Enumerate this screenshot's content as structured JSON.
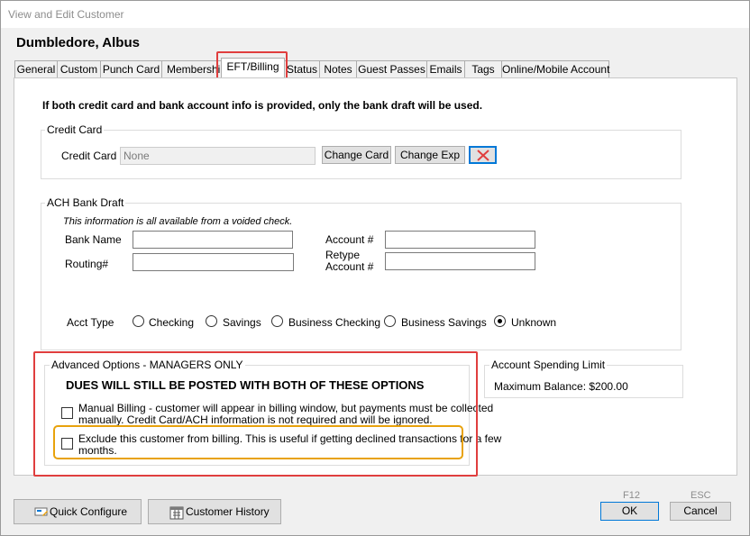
{
  "window": {
    "title": "View and Edit Customer"
  },
  "customer": {
    "name": "Dumbledore, Albus"
  },
  "tabs": [
    {
      "label": "General"
    },
    {
      "label": "Custom"
    },
    {
      "label": "Punch Card"
    },
    {
      "label": "Membership"
    },
    {
      "label": "EFT/Billing",
      "active": true
    },
    {
      "label": "Status"
    },
    {
      "label": "Notes"
    },
    {
      "label": "Guest Passes"
    },
    {
      "label": "Emails"
    },
    {
      "label": "Tags"
    },
    {
      "label": "Online/Mobile Account"
    }
  ],
  "notice": "If both credit card and bank account info is provided, only the bank draft will be used.",
  "credit_card": {
    "group_label": "Credit Card",
    "field_label": "Credit Card",
    "value": "None",
    "change_card_label": "Change Card",
    "change_exp_label": "Change Exp"
  },
  "ach": {
    "group_label": "ACH Bank Draft",
    "hint": "This information is all available from a voided check.",
    "bank_name_label": "Bank Name",
    "routing_label": "Routing#",
    "account_label": "Account #",
    "retype_label_line1": "Retype",
    "retype_label_line2": "Account #",
    "bank_name_value": "",
    "routing_value": "",
    "account_value": "",
    "retype_value": "",
    "acct_type_label": "Acct Type",
    "acct_types": [
      {
        "label": "Checking",
        "checked": false
      },
      {
        "label": "Savings",
        "checked": false
      },
      {
        "label": "Business Checking",
        "checked": false
      },
      {
        "label": "Business Savings",
        "checked": false
      },
      {
        "label": "Unknown",
        "checked": true
      }
    ]
  },
  "advanced": {
    "group_label": "Advanced Options - MANAGERS ONLY",
    "warning": "DUES WILL STILL BE POSTED WITH BOTH OF THESE OPTIONS",
    "manual_billing_line1": "Manual Billing - customer will appear in billing window, but payments must be collected",
    "manual_billing_line2": "manually. Credit Card/ACH information is not required and will be ignored.",
    "manual_billing_checked": false,
    "exclude_line1": "Exclude this customer from billing.  This is useful if getting declined transactions for a few",
    "exclude_line2": "months.",
    "exclude_checked": false
  },
  "spending_limit": {
    "group_label": "Account Spending Limit",
    "label": "Maximum Balance: $200.00"
  },
  "footer": {
    "quick_configure_label": "Quick Configure",
    "customer_history_label": "Customer History",
    "ok_label": "OK",
    "ok_key": "F12",
    "cancel_label": "Cancel",
    "cancel_key": "ESC"
  },
  "colors": {
    "highlight_red": "#e03e3e",
    "highlight_orange": "#e8a20c",
    "focus_blue": "#0078d7"
  },
  "icons": [
    "delete-x-icon",
    "quick-configure-icon",
    "calendar-history-icon"
  ]
}
